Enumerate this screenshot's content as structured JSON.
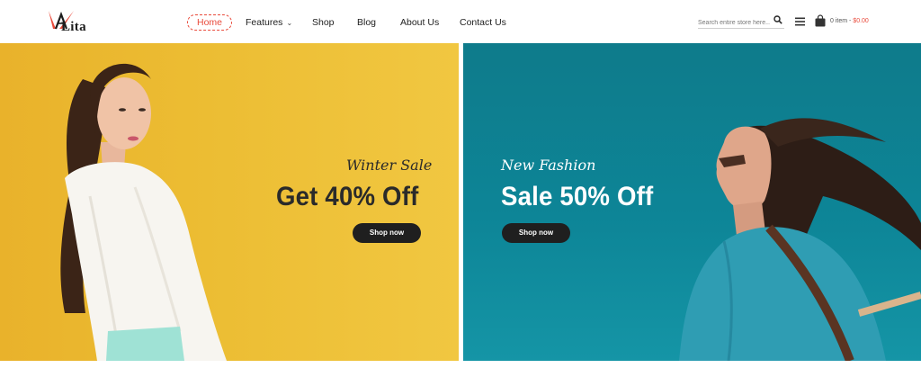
{
  "header": {
    "logo_text": "Lita",
    "logo_letter": "A",
    "nav": [
      {
        "label": "Home",
        "active": true
      },
      {
        "label": "Features",
        "has_dropdown": true
      },
      {
        "label": "Shop"
      },
      {
        "label": "Blog"
      },
      {
        "label": "About Us"
      },
      {
        "label": "Contact Us"
      }
    ],
    "search_placeholder": "Search entire store here...",
    "cart_items": "0 item -",
    "cart_price": "$0.00",
    "icons": [
      "search-icon",
      "menu-icon",
      "shopping-bag-icon",
      "chevron-down-icon"
    ]
  },
  "banners": [
    {
      "script_text": "Winter Sale",
      "headline": "Get 40% Off",
      "button_label": "Shop now",
      "background": "#ecbd33"
    },
    {
      "script_text": "New Fashion",
      "headline": "Sale 50% Off",
      "button_label": "Shop now",
      "background": "#0e8192"
    }
  ],
  "colors": {
    "accent": "#e94b3c",
    "button_bg": "#1f1f1f",
    "dark_text": "#2a2a2a"
  }
}
